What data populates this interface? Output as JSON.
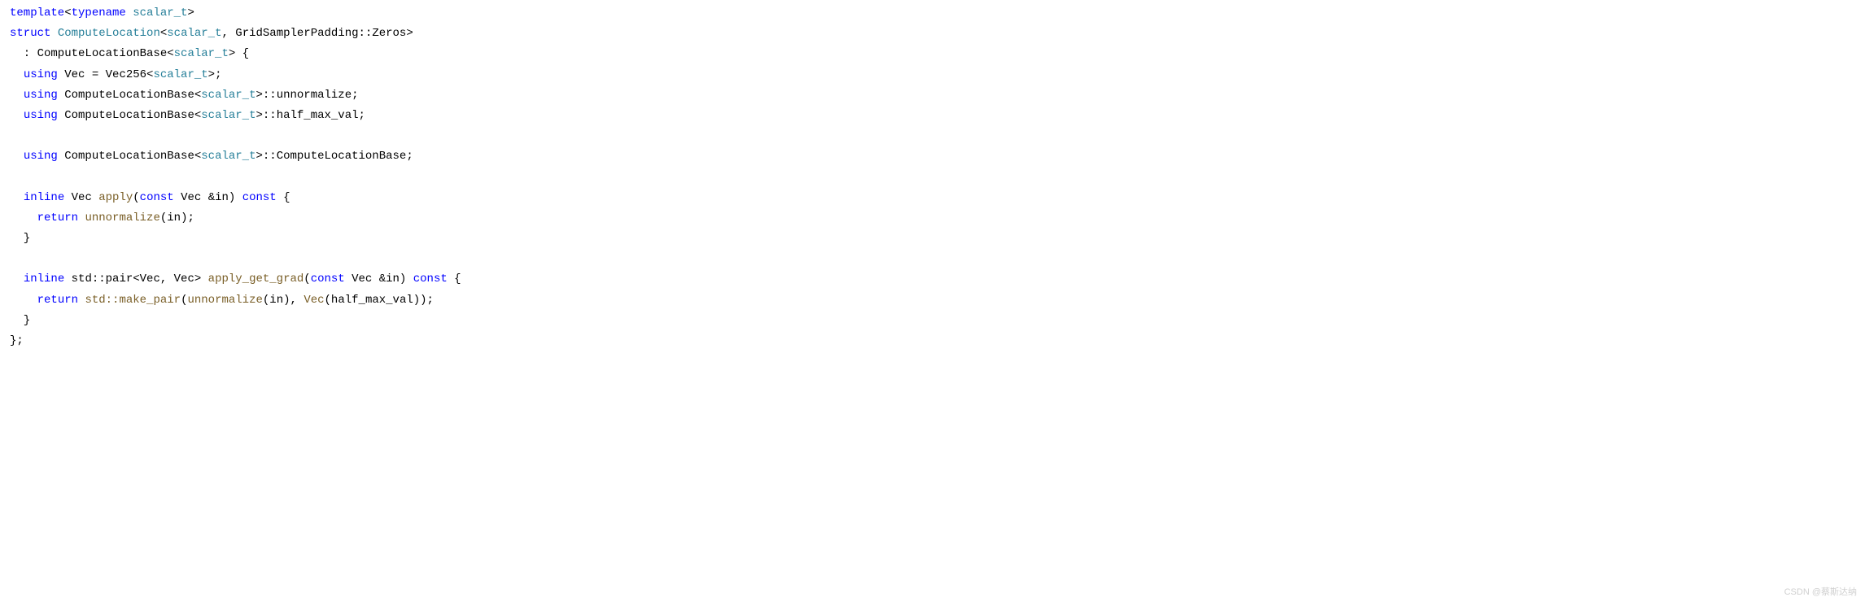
{
  "code": {
    "l1": {
      "template": "template",
      "lt1": "<",
      "typename": "typename",
      "sp": " ",
      "scalar_t": "scalar_t",
      "gt1": ">"
    },
    "l2": {
      "struct": "struct",
      "sp": " ",
      "ComputeLocation": "ComputeLocation",
      "lt": "<",
      "scalar_t": "scalar_t",
      "rest": ", GridSamplerPadding::Zeros>"
    },
    "l3": {
      "pre": "  : ComputeLocationBase<",
      "scalar_t": "scalar_t",
      "post": "> {"
    },
    "l4": {
      "pre": "  ",
      "using": "using",
      "mid": " Vec = Vec256<",
      "scalar_t": "scalar_t",
      "post": ">;"
    },
    "l5": {
      "pre": "  ",
      "using": "using",
      "mid": " ComputeLocationBase<",
      "scalar_t": "scalar_t",
      "post": ">::unnormalize;"
    },
    "l6": {
      "pre": "  ",
      "using": "using",
      "mid": " ComputeLocationBase<",
      "scalar_t": "scalar_t",
      "post": ">::half_max_val;"
    },
    "l7": {
      "pre": "  ",
      "using": "using",
      "mid": " ComputeLocationBase<",
      "scalar_t": "scalar_t",
      "post": ">::ComputeLocationBase;"
    },
    "l8": {
      "pre": "  ",
      "inline": "inline",
      "mid1": " Vec ",
      "apply": "apply",
      "p1": "(",
      "const": "const",
      "mid2": " Vec &in) ",
      "const2": "const",
      "post": " {"
    },
    "l9": {
      "pre": "    ",
      "return": "return",
      "sp": " ",
      "unnormalize": "unnormalize",
      "post": "(in);"
    },
    "l10": {
      "txt": "  }"
    },
    "l11": {
      "pre": "  ",
      "inline": "inline",
      "mid1": " std::pair<Vec, Vec> ",
      "apply_get_grad": "apply_get_grad",
      "p1": "(",
      "const": "const",
      "mid2": " Vec &in) ",
      "const2": "const",
      "post": " {"
    },
    "l12": {
      "pre": "    ",
      "return": "return",
      "sp": " ",
      "make_pair": "std::make_pair",
      "p1": "(",
      "unnormalize": "unnormalize",
      "p2": "(in), ",
      "Vec": "Vec",
      "post": "(half_max_val));"
    },
    "l13": {
      "txt": "  }"
    },
    "l14": {
      "txt": "};"
    }
  },
  "watermark": "CSDN @蔡斯达纳"
}
